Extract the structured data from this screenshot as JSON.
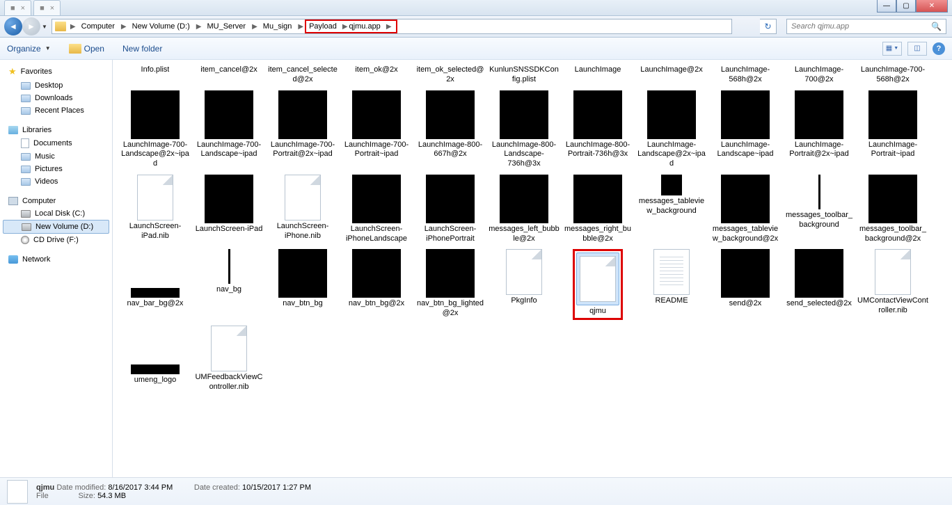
{
  "titlebar": {
    "tab1": "",
    "tab2": ""
  },
  "breadcrumb": {
    "c0": "Computer",
    "c1": "New Volume (D:)",
    "c2": "MU_Server",
    "c3": "Mu_sign",
    "c4": "Payload",
    "c5": "qjmu.app"
  },
  "search": {
    "placeholder": "Search qjmu.app"
  },
  "toolbar": {
    "organize": "Organize",
    "open": "Open",
    "newfolder": "New folder"
  },
  "sidebar": {
    "favorites": "Favorites",
    "desktop": "Desktop",
    "downloads": "Downloads",
    "recent": "Recent Places",
    "libraries": "Libraries",
    "documents": "Documents",
    "music": "Music",
    "pictures": "Pictures",
    "videos": "Videos",
    "computer": "Computer",
    "local_c": "Local Disk (C:)",
    "new_d": "New Volume (D:)",
    "cd_f": "CD Drive (F:)",
    "network": "Network"
  },
  "files": {
    "row0": [
      "Info.plist",
      "item_cancel@2x",
      "item_cancel_selected@2x",
      "item_ok@2x",
      "item_ok_selected@2x",
      "KunlunSNSSDKConfig.plist",
      "LaunchImage",
      "LaunchImage@2x",
      "LaunchImage-568h@2x",
      "LaunchImage-700@2x",
      "LaunchImage-700-568h@2x"
    ],
    "row1": [
      "LaunchImage-700-Landscape@2x~ipad",
      "LaunchImage-700-Landscape~ipad",
      "LaunchImage-700-Portrait@2x~ipad",
      "LaunchImage-700-Portrait~ipad",
      "LaunchImage-800-667h@2x",
      "LaunchImage-800-Landscape-736h@3x",
      "LaunchImage-800-Portrait-736h@3x",
      "LaunchImage-Landscape@2x~ipad",
      "LaunchImage-Landscape~ipad",
      "LaunchImage-Portrait@2x~ipad",
      "LaunchImage-Portrait~ipad"
    ],
    "row2": [
      "LaunchScreen-iPad.nib",
      "LaunchScreen-iPad",
      "LaunchScreen-iPhone.nib",
      "LaunchScreen-iPhoneLandscape",
      "LaunchScreen-iPhonePortrait",
      "messages_left_bubble@2x",
      "messages_right_bubble@2x",
      "messages_tableview_background",
      "messages_tableview_background@2x",
      "messages_toolbar_background",
      "messages_toolbar_background@2x"
    ],
    "row3": [
      "nav_bar_bg@2x",
      "nav_bg",
      "nav_btn_bg",
      "nav_btn_bg@2x",
      "nav_btn_bg_lighted@2x",
      "PkgInfo",
      "qjmu",
      "README",
      "send@2x",
      "send_selected@2x",
      "UMContactViewController.nib"
    ],
    "row4": [
      "umeng_logo",
      "UMFeedbackViewController.nib"
    ]
  },
  "thumbTypes": {
    "row2": [
      "doc",
      "black",
      "doc",
      "black",
      "black",
      "black",
      "black",
      "small",
      "black",
      "thin",
      "black"
    ],
    "row3": [
      "short",
      "thin",
      "black",
      "black",
      "black",
      "doc",
      "doc",
      "txt",
      "black",
      "black",
      "doc"
    ],
    "row4": [
      "short",
      "doc"
    ]
  },
  "details": {
    "name": "qjmu",
    "mod_label": "Date modified:",
    "mod": "8/16/2017 3:44 PM",
    "created_label": "Date created:",
    "created": "10/15/2017 1:27 PM",
    "type_label": "File",
    "size_label": "Size:",
    "size": "54.3 MB"
  }
}
